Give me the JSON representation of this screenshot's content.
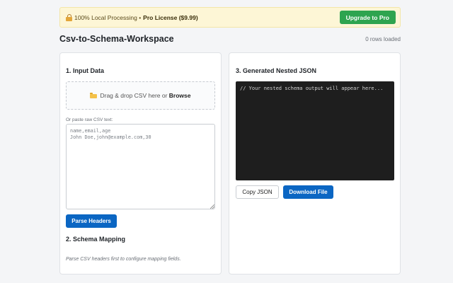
{
  "banner": {
    "local_text": "100% Local Processing • ",
    "license_text": "Pro License ($9.99)",
    "upgrade_label": "Upgrade to Pro",
    "icon": "lock-icon"
  },
  "header": {
    "title": "Csv-to-Schema-Workspace",
    "row_count": "0 rows loaded"
  },
  "input_panel": {
    "title": "1. Input Data",
    "dropzone_text": "Drag & drop CSV here or ",
    "dropzone_link": "Browse",
    "dropzone_icon": "folder-icon",
    "paste_label": "Or paste raw CSV text:",
    "textarea_placeholder": "name,email,age\nJohn Doe,john@example.com,30",
    "textarea_value": "",
    "parse_label": "Parse Headers"
  },
  "mapping_panel": {
    "title": "2. Schema Mapping",
    "hint": "Parse CSV headers first to configure mapping fields."
  },
  "output_panel": {
    "title": "3. Generated Nested JSON",
    "output_placeholder": "// Your nested schema output will appear here...",
    "copy_label": "Copy JSON",
    "download_label": "Download File"
  },
  "colors": {
    "accent": "#0b66c3",
    "upgrade": "#2ea44f",
    "banner_bg": "#fdf6d6",
    "code_bg": "#1e1e1e"
  }
}
